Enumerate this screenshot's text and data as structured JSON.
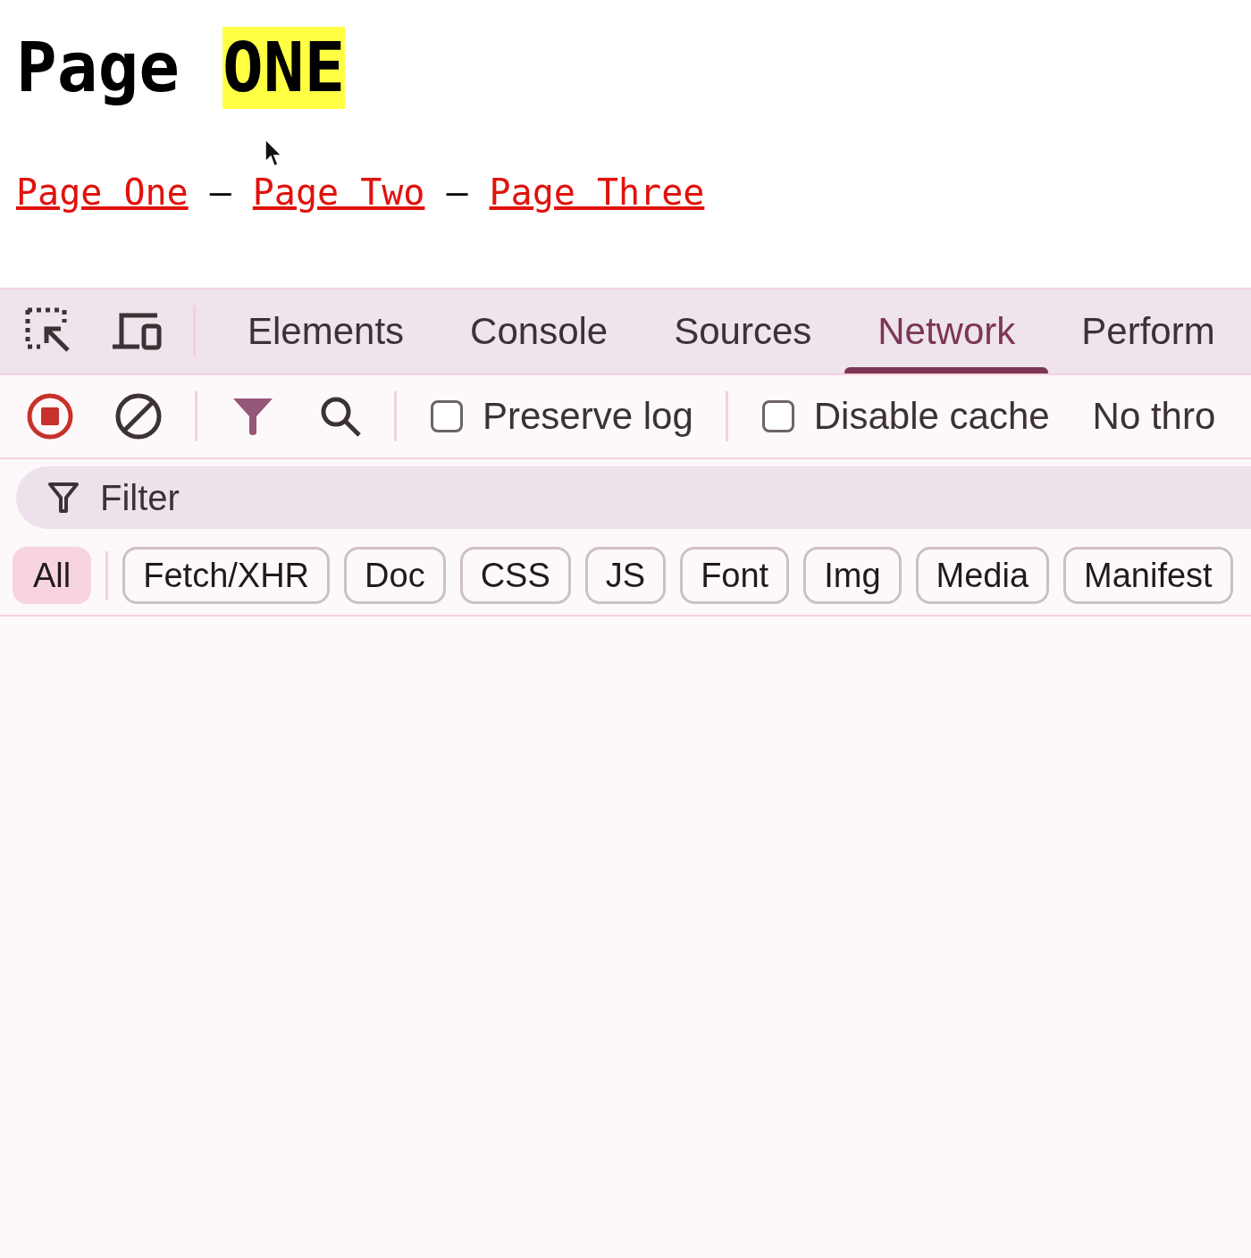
{
  "page": {
    "heading": {
      "text": "Page",
      "highlight": "ONE"
    },
    "links": [
      {
        "label": "Page One"
      },
      {
        "label": "Page Two"
      },
      {
        "label": "Page Three"
      }
    ],
    "separators": [
      "–",
      "–"
    ]
  },
  "devtools": {
    "tabs": [
      {
        "label": "Elements",
        "selected": false
      },
      {
        "label": "Console",
        "selected": false
      },
      {
        "label": "Sources",
        "selected": false
      },
      {
        "label": "Network",
        "selected": true
      },
      {
        "label": "Perform",
        "selected": false
      }
    ],
    "toolbar": {
      "recording": true,
      "checkboxes": [
        {
          "label": "Preserve log",
          "checked": false
        },
        {
          "label": "Disable cache",
          "checked": false
        }
      ],
      "throttle": "No thro"
    },
    "filter": {
      "placeholder": "Filter"
    },
    "types": [
      {
        "label": "All",
        "selected": true
      },
      {
        "label": "Fetch/XHR",
        "selected": false
      },
      {
        "label": "Doc",
        "selected": false
      },
      {
        "label": "CSS",
        "selected": false
      },
      {
        "label": "JS",
        "selected": false
      },
      {
        "label": "Font",
        "selected": false
      },
      {
        "label": "Img",
        "selected": false
      },
      {
        "label": "Media",
        "selected": false
      },
      {
        "label": "Manifest",
        "selected": false
      }
    ]
  }
}
